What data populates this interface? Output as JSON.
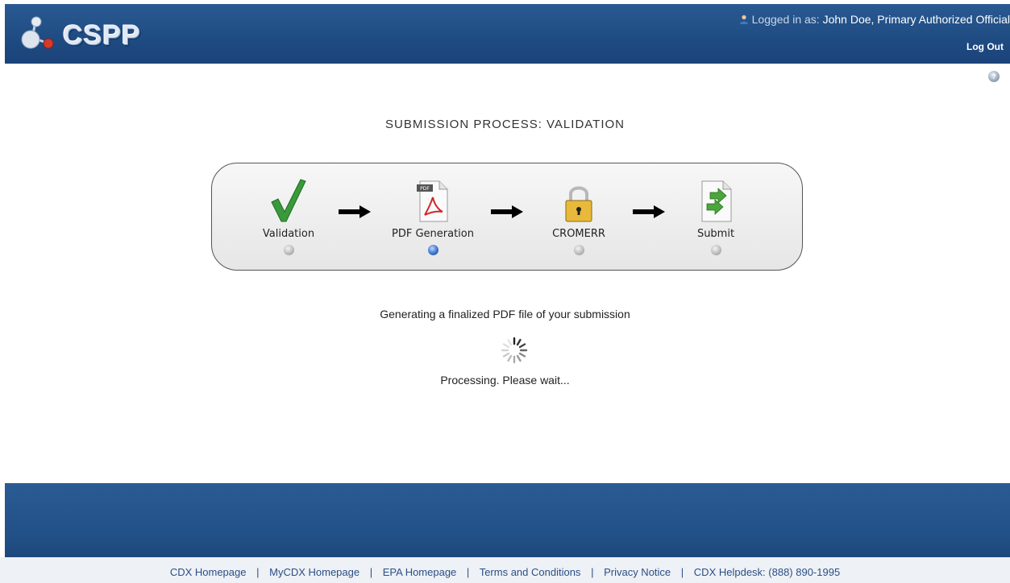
{
  "header": {
    "app_name": "CSPP",
    "logged_in_label": "Logged in as:",
    "user": "John Doe, Primary Authorized Official",
    "logout_label": "Log Out"
  },
  "help_icon_glyph": "?",
  "page_title": "SUBMISSION PROCESS: VALIDATION",
  "steps": [
    {
      "label": "Validation",
      "icon": "checkmark-icon",
      "active": false
    },
    {
      "label": "PDF Generation",
      "icon": "pdf-document-icon",
      "active": true
    },
    {
      "label": "CROMERR",
      "icon": "padlock-icon",
      "active": false
    },
    {
      "label": "Submit",
      "icon": "submit-document-icon",
      "active": false
    }
  ],
  "status_message": "Generating a finalized PDF file of your submission",
  "processing_text": "Processing. Please wait...",
  "footer": {
    "links": [
      "CDX Homepage",
      "MyCDX Homepage",
      "EPA Homepage",
      "Terms and Conditions",
      "Privacy Notice",
      "CDX Helpdesk: (888) 890-1995"
    ],
    "separator": "|"
  },
  "colors": {
    "header_blue": "#1f4c83",
    "active_dot": "#3b74c9",
    "check_green": "#3a9a3a",
    "footer_link": "#2b4f86"
  }
}
